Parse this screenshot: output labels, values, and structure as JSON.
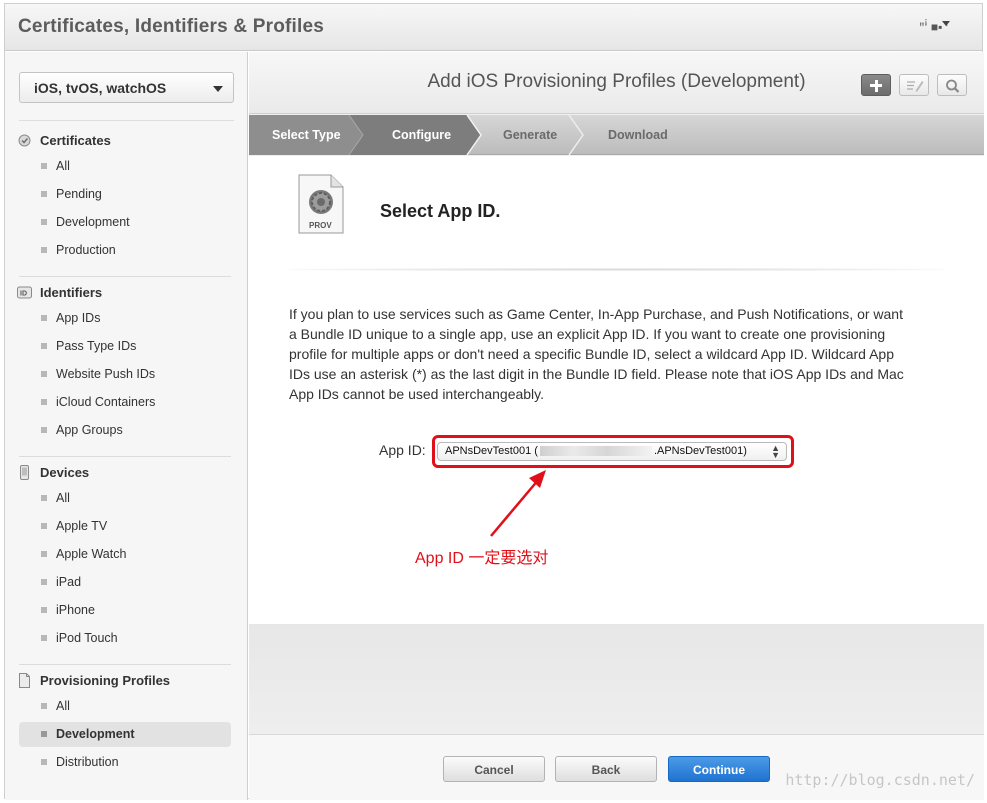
{
  "app": {
    "title": "Certificates, Identifiers & Profiles",
    "user": "ꞌꞌꜞ ■▪ ꞌ"
  },
  "sidebar": {
    "platform": "iOS, tvOS, watchOS",
    "groups": [
      {
        "label": "Certificates",
        "icon": "certificate-icon",
        "items": [
          "All",
          "Pending",
          "Development",
          "Production"
        ]
      },
      {
        "label": "Identifiers",
        "icon": "id-icon",
        "items": [
          "App IDs",
          "Pass Type IDs",
          "Website Push IDs",
          "iCloud Containers",
          "App Groups"
        ]
      },
      {
        "label": "Devices",
        "icon": "device-icon",
        "items": [
          "All",
          "Apple TV",
          "Apple Watch",
          "iPad",
          "iPhone",
          "iPod Touch"
        ]
      },
      {
        "label": "Provisioning Profiles",
        "icon": "document-icon",
        "items": [
          "All",
          "Development",
          "Distribution"
        ]
      }
    ],
    "selected": "Provisioning Profiles / Development"
  },
  "main": {
    "title": "Add iOS Provisioning Profiles (Development)",
    "toolbar": [
      "add-icon",
      "edit-icon",
      "search-icon"
    ],
    "steps": [
      "Select Type",
      "Configure",
      "Generate",
      "Download"
    ],
    "prov_icon_label": "PROV",
    "section_title": "Select App ID.",
    "description": "If you plan to use services such as Game Center, In-App Purchase, and Push Notifications, or want a Bundle ID unique to a single app, use an explicit App ID. If you want to create one provisioning profile for multiple apps or don't need a specific Bundle ID, select a wildcard App ID. Wildcard App IDs use an asterisk (*) as the last digit in the Bundle ID field. Please note that iOS App IDs and Mac App IDs cannot be used interchangeably.",
    "app_id_label": "App ID:",
    "app_id_value_start": "APNsDevTest001 (",
    "app_id_value_end": ".APNsDevTest001)",
    "annotation": "App ID 一定要选对",
    "annotation_color": "#e0101a"
  },
  "footer": {
    "cancel": "Cancel",
    "back": "Back",
    "continue": "Continue"
  },
  "watermark": "http://blog.csdn.net/"
}
